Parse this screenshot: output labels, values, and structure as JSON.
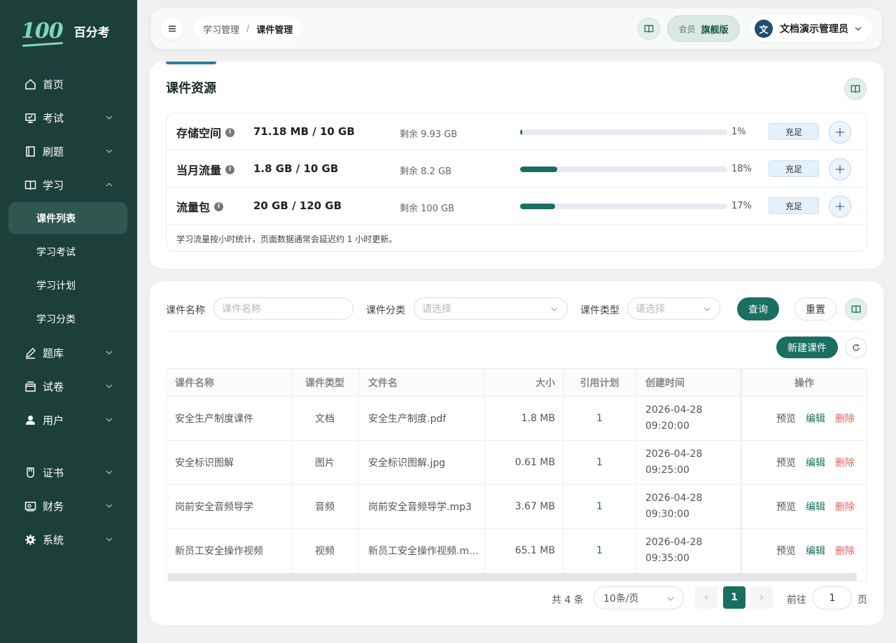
{
  "brand": {
    "logo": "100",
    "name": "百分考"
  },
  "sidebar": {
    "items": [
      {
        "label": "首页",
        "icon": "home-icon"
      },
      {
        "label": "考试",
        "icon": "exam-icon"
      },
      {
        "label": "刷题",
        "icon": "practice-icon"
      },
      {
        "label": "学习",
        "icon": "book-icon"
      },
      {
        "label": "题库",
        "icon": "pen-icon"
      },
      {
        "label": "试卷",
        "icon": "paper-icon"
      },
      {
        "label": "用户",
        "icon": "user-icon"
      },
      {
        "label": "证书",
        "icon": "certificate-icon"
      },
      {
        "label": "财务",
        "icon": "finance-icon"
      },
      {
        "label": "系统",
        "icon": "gear-icon"
      }
    ],
    "sub_items": [
      "课件列表",
      "学习考试",
      "学习计划",
      "学习分类"
    ]
  },
  "header": {
    "breadcrumb": [
      "学习管理",
      "课件管理"
    ],
    "breadcrumb_sep": "/",
    "member_label": "会员",
    "member_level": "旗舰版",
    "avatar_text": "文",
    "user_name": "文档演示管理员"
  },
  "resources": {
    "title": "课件资源",
    "rows": [
      {
        "name": "存储空间",
        "usage": "71.18 MB / 10 GB",
        "remaining": "剩余 9.93 GB",
        "percent": "1%",
        "fill": 1,
        "action": "充足"
      },
      {
        "name": "当月流量",
        "usage": "1.8 GB / 10 GB",
        "remaining": "剩余 8.2 GB",
        "percent": "18%",
        "fill": 18,
        "action": "充足"
      },
      {
        "name": "流量包",
        "usage": "20 GB / 120 GB",
        "remaining": "剩余 100 GB",
        "percent": "17%",
        "fill": 17,
        "action": "充足"
      }
    ],
    "note": "学习流量按小时统计，页面数据通常会延迟约 1 小时更新。"
  },
  "filters": {
    "name_label": "课件名称",
    "name_placeholder": "课件名称",
    "category_label": "课件分类",
    "category_placeholder": "请选择",
    "type_label": "课件类型",
    "type_placeholder": "请选择",
    "query": "查询",
    "reset": "重置"
  },
  "new_button": "新建课件",
  "table": {
    "columns": [
      "课件名称",
      "课件类型",
      "文件名",
      "大小",
      "引用计划",
      "创建时间",
      "操作"
    ],
    "rows": [
      {
        "name": "安全生产制度课件",
        "type": "文档",
        "file": "安全生产制度.pdf",
        "size": "1.8 MB",
        "refs": "1",
        "date": "2026-04-28",
        "time": "09:20:00"
      },
      {
        "name": "安全标识图解",
        "type": "图片",
        "file": "安全标识图解.jpg",
        "size": "0.61 MB",
        "refs": "1",
        "date": "2026-04-28",
        "time": "09:25:00"
      },
      {
        "name": "岗前安全音频导学",
        "type": "音频",
        "file": "岗前安全音频导学.mp3",
        "size": "3.67 MB",
        "refs": "1",
        "date": "2026-04-28",
        "time": "09:30:00"
      },
      {
        "name": "新员工安全操作视频",
        "type": "视频",
        "file": "新员工安全操作视频.m...",
        "size": "65.1 MB",
        "refs": "1",
        "date": "2026-04-28",
        "time": "09:35:00"
      }
    ],
    "actions": {
      "preview": "预览",
      "edit": "编辑",
      "delete": "删除"
    }
  },
  "pagination": {
    "total": "共 4 条",
    "page_size": "10条/页",
    "current": "1",
    "goto_label": "前往",
    "goto_value": "1",
    "page_suffix": "页"
  },
  "colors": {
    "sidebar": "#1c3f3a",
    "primary": "#1a6e62",
    "danger": "#e0605e",
    "accent": "#7fd7b5"
  }
}
